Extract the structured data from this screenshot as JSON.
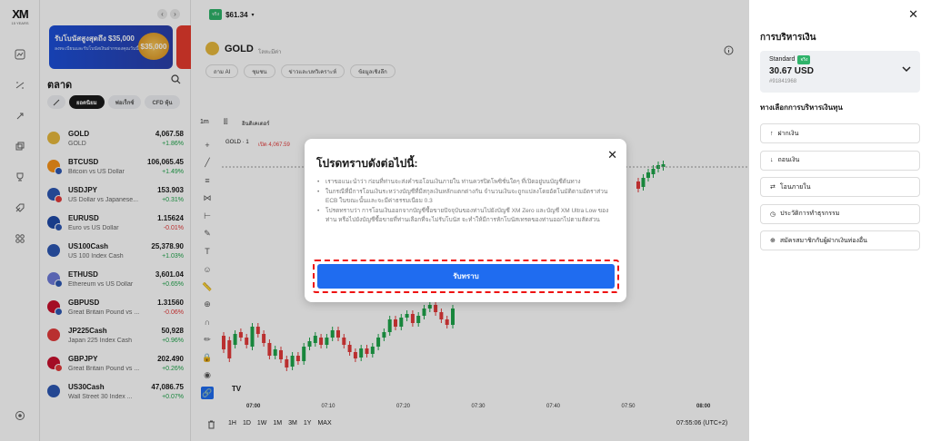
{
  "brand": {
    "logo_text": "XM",
    "years": "15 YEARS"
  },
  "banner": {
    "title": "รับโบนัสสูงสุดถึง $35,000",
    "subtitle": "ลงทะเบียนและรับโบนัสเงินฝากของคุณวันนี้",
    "amount": "$35,000",
    "prev": "‹",
    "next": "›"
  },
  "market": {
    "title": "ตลาด",
    "tabs": [
      "ยอดนิยม",
      "ฟอเร็กซ์",
      "CFD หุ้น"
    ],
    "rows": [
      {
        "symbol": "GOLD",
        "desc": "GOLD",
        "price": "4,067.58",
        "change": "+1.86%",
        "dir": "up",
        "c1": "#e7b93e",
        "c2": ""
      },
      {
        "symbol": "BTCUSD",
        "desc": "Bitcoin vs US Dollar",
        "price": "106,065.45",
        "change": "+1.49%",
        "dir": "up",
        "c1": "#f7931a",
        "c2": "#2d57b3"
      },
      {
        "symbol": "USDJPY",
        "desc": "US Dollar vs Japanese...",
        "price": "153.903",
        "change": "+0.31%",
        "dir": "up",
        "c1": "#2d57b3",
        "c2": "#e23b3b"
      },
      {
        "symbol": "EURUSD",
        "desc": "Euro vs US Dollar",
        "price": "1.15624",
        "change": "-0.01%",
        "dir": "dn",
        "c1": "#1f4aa8",
        "c2": "#2d57b3"
      },
      {
        "symbol": "US100Cash",
        "desc": "US 100 Index Cash",
        "price": "25,378.90",
        "change": "+1.03%",
        "dir": "up",
        "c1": "#2d57b3",
        "c2": ""
      },
      {
        "symbol": "ETHUSD",
        "desc": "Ethereum vs US Dollar",
        "price": "3,601.04",
        "change": "+0.65%",
        "dir": "up",
        "c1": "#6d7bd8",
        "c2": "#2d57b3"
      },
      {
        "symbol": "GBPUSD",
        "desc": "Great Britain Pound vs ...",
        "price": "1.31560",
        "change": "-0.06%",
        "dir": "dn",
        "c1": "#c8102e",
        "c2": "#2d57b3"
      },
      {
        "symbol": "JP225Cash",
        "desc": "Japan 225 Index Cash",
        "price": "50,928",
        "change": "+0.96%",
        "dir": "up",
        "c1": "#e23b3b",
        "c2": ""
      },
      {
        "symbol": "GBPJPY",
        "desc": "Great Britain Pound vs ...",
        "price": "202.490",
        "change": "+0.26%",
        "dir": "up",
        "c1": "#c8102e",
        "c2": "#e23b3b"
      },
      {
        "symbol": "US30Cash",
        "desc": "Wall Street 30 Index ...",
        "price": "47,086.75",
        "change": "+0.07%",
        "dir": "up",
        "c1": "#2d57b3",
        "c2": ""
      }
    ]
  },
  "chart": {
    "account_badge": "จริง",
    "balance_short": "$61.34",
    "symbol": "GOLD",
    "symbol_sub": "โลหะมีค่า",
    "pills": [
      "ถาม AI",
      "ชุมชน",
      "ข่าวและบทวิเคราะห์",
      "ข้อมูลเชิงลึก"
    ],
    "interval": "1m",
    "indicators_label": "อินดิเคเตอร์",
    "legend_symbol": "GOLD · 1",
    "legend_open": "เปิด 4,067.59",
    "time_labels": [
      "07:00",
      "07:10",
      "07:20",
      "07:30",
      "07:40",
      "07:50",
      "08:00"
    ],
    "ranges": [
      "1H",
      "1D",
      "1W",
      "1M",
      "3M",
      "1Y",
      "MAX"
    ],
    "clock": "07:55:06 (UTC+2)",
    "colors": {
      "up": "#1ea44a",
      "down": "#e33a3a"
    }
  },
  "modal": {
    "title": "โปรดทราบดังต่อไปนี้:",
    "bullets": [
      "เราขอแนะนำว่า ก่อนที่ท่านจะส่งคำขอโอนเงินภายใน ท่านควรปิดโพซิชั่นใดๆ ที่เปิดอยู่บนบัญชีต้นทาง",
      "ในกรณีที่มีการโอนเงินระหว่างบัญชีที่มีสกุลเงินหลักแตกต่างกัน จำนวนเงินจะถูกแปลงโดยอัตโนมัติตามอัตราส่วน ECB ในขณะนั้นและจะมีค่าธรรมเนียม 0.3",
      "โปรดทราบว่า การโอนเงินออกจากบัญชีซื้อขายปัจจุบันของท่านไปยังบัญชี XM Zero และบัญชี XM Ultra Low ของท่าน หรือไปยังบัญชีซื้อขายที่ท่านเลือกที่จะไม่รับโบนัส จะทำให้มีการหักโบนัสเทรดของท่านออกไปตามสัดส่วน"
    ],
    "ok_label": "รับทราบ"
  },
  "panel": {
    "title": "การบริหารเงิน",
    "account_type": "Standard",
    "account_badge": "จริง",
    "balance": "30.67 USD",
    "account_number": "#91841968",
    "subtitle": "ทางเลือกการบริหารเงินทุน",
    "actions": [
      {
        "label": "ฝากเงิน",
        "icon": "↑"
      },
      {
        "label": "ถอนเงิน",
        "icon": "↓"
      },
      {
        "label": "โอนภายใน",
        "icon": "⇄"
      },
      {
        "label": "ประวัติการทำธุรกรรม",
        "icon": "◷"
      },
      {
        "label": "สมัครสมาชิกกับผู้ฝากเงินท่องอื่น",
        "icon": "⊕"
      }
    ]
  }
}
